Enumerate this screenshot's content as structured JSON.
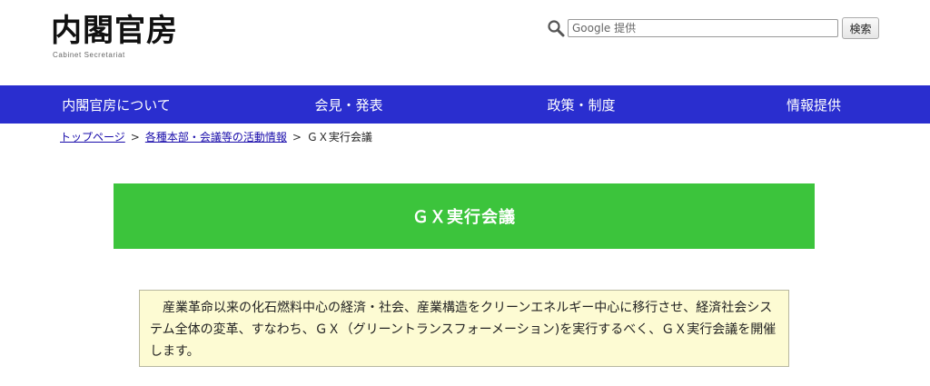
{
  "header": {
    "logo_text": "内閣官房",
    "logo_subtext": "Cabinet Secretariat",
    "search": {
      "placeholder": "Google 提供",
      "button_label": "検索"
    }
  },
  "nav": {
    "items": [
      {
        "label": "内閣官房について"
      },
      {
        "label": "会見・発表"
      },
      {
        "label": "政策・制度"
      },
      {
        "label": "情報提供"
      }
    ]
  },
  "breadcrumb": {
    "items": [
      {
        "label": "トップページ"
      },
      {
        "label": "各種本部・会議等の活動情報"
      },
      {
        "label": "ＧＸ実行会議"
      }
    ],
    "separator": ">"
  },
  "main": {
    "title": "ＧＸ実行会議",
    "intro": "産業革命以来の化石燃料中心の経済・社会、産業構造をクリーンエネルギー中心に移行させ、経済社会システム全体の変革、すなわち、ＧＸ（グリーントランスフォーメーション)を実行するべく、ＧＸ実行会議を開催します。"
  },
  "colors": {
    "nav_background": "#2a2ecf",
    "title_background": "#3cc43c",
    "intro_background": "#fdfbd3",
    "link": "#1a0dab"
  }
}
